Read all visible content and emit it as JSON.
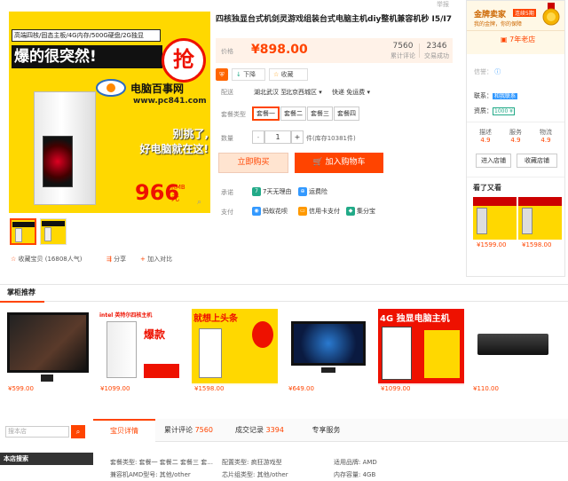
{
  "report": "举报",
  "hero": {
    "spec_strip": "高端四核/固态主板/4G内存/500G硬盘/2G独显",
    "headline": "爆的很突然!",
    "grab": "抢",
    "site_name": "电脑百事网",
    "site_url": "www.pc841.com",
    "slogan_1": "别挑了,",
    "slogan_2": "好电脑就在这!",
    "price": "966",
    "price_unit": "RMB",
    "yuan": "元"
  },
  "gallery_links": {
    "favorite": "收藏宝贝 (16808人气)",
    "share": "分享",
    "compare": "加入对比"
  },
  "product": {
    "title": "四核独显台式机剑灵游戏组装台式电脑主机diy整机兼容机秒 I5/I7",
    "price_label": "价格",
    "price": "¥898.00",
    "stats": [
      {
        "value": "7560",
        "label": "累计评论"
      },
      {
        "value": "2346",
        "label": "交易成功"
      }
    ],
    "price_drop": "下降",
    "collect": "收藏",
    "shipping_label": "配送",
    "shipping_from": "湖北武汉 至",
    "shipping_to": "北京西城区",
    "shipping_method": "快递 免运费",
    "package_label": "套餐类型",
    "packages": [
      "套餐一",
      "套餐二",
      "套餐三",
      "套餐四"
    ],
    "qty_label": "数量",
    "qty_minus": "-",
    "qty": "1",
    "qty_plus": "+",
    "stock": "件(库存10381件)",
    "buy_now": "立即购买",
    "add_cart": "加入购物车",
    "promise_label": "承诺",
    "promise_1": "7天无理由",
    "promise_2": "运费险",
    "pay_label": "支付",
    "pay_1": "蚂蚁花呗",
    "pay_2": "信用卡支付",
    "pay_3": "集分宝"
  },
  "shop": {
    "level": "金牌卖家",
    "level_sub": "连续5期",
    "level_desc": "我的金牌，你的保障",
    "years": "7年老店",
    "seller_label": "信誉：",
    "contact_label": "联系：",
    "contact_value": "和我联系",
    "qual_label": "资质：",
    "qual_value": "1000 ¥",
    "ratings": [
      {
        "label": "描述",
        "score": "4.9"
      },
      {
        "label": "服务",
        "score": "4.9"
      },
      {
        "label": "物流",
        "score": "4.9"
      }
    ],
    "enter_store": "进入店铺",
    "fav_store": "收藏店铺",
    "see_also_title": "看了又看",
    "see_also": [
      {
        "price": "¥1599.00"
      },
      {
        "price": "¥1598.00"
      }
    ]
  },
  "recommend": {
    "title": "掌柜推荐",
    "items": [
      {
        "price": "¥599.00",
        "caption": ""
      },
      {
        "price": "¥1099.00",
        "caption": "intel 英特尔四核主机"
      },
      {
        "price": "¥1598.00",
        "caption": "就想上头条"
      },
      {
        "price": "¥649.00",
        "caption": ""
      },
      {
        "price": "¥1099.00",
        "caption": "4G 独显电脑主机"
      },
      {
        "price": "¥110.00",
        "caption": ""
      }
    ]
  },
  "bottom": {
    "search_placeholder": "搜本店",
    "search_btn": "⌕",
    "store_search": "本店搜索",
    "tabs": [
      {
        "label": "宝贝详情",
        "count": ""
      },
      {
        "label": "累计评论",
        "count": "7560"
      },
      {
        "label": "成交记录",
        "count": "3394"
      },
      {
        "label": "专享服务",
        "count": ""
      }
    ],
    "attrs": [
      "套餐类型: 套餐一 套餐二 套餐三 套...",
      "配置类型: 疯狂游戏型",
      "适用品牌: AMD",
      "兼容机AMD型号: 其他/other",
      "芯片组类型: 其他/other",
      "内存容量: 4GB"
    ]
  },
  "colors": {
    "accent": "#ff4400",
    "hero_bg": "#ffd800"
  }
}
